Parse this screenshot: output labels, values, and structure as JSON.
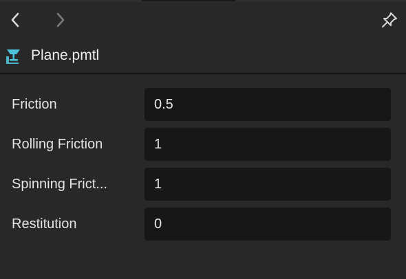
{
  "nav": {
    "back_icon": "chevron-left-icon",
    "forward_icon": "chevron-right-icon",
    "pin_icon": "pin-icon"
  },
  "header": {
    "icon": "material-icon",
    "icon_color": "#4cc3dc",
    "title": "Plane.pmtl"
  },
  "properties": [
    {
      "label": "Friction",
      "value": "0.5"
    },
    {
      "label": "Rolling Friction",
      "value": "1"
    },
    {
      "label": "Spinning Frict...",
      "value": "1"
    },
    {
      "label": "Restitution",
      "value": "0"
    }
  ],
  "colors": {
    "background": "#282828",
    "field": "#171717",
    "text": "#e4e4e4",
    "accent": "#4cc3dc"
  }
}
